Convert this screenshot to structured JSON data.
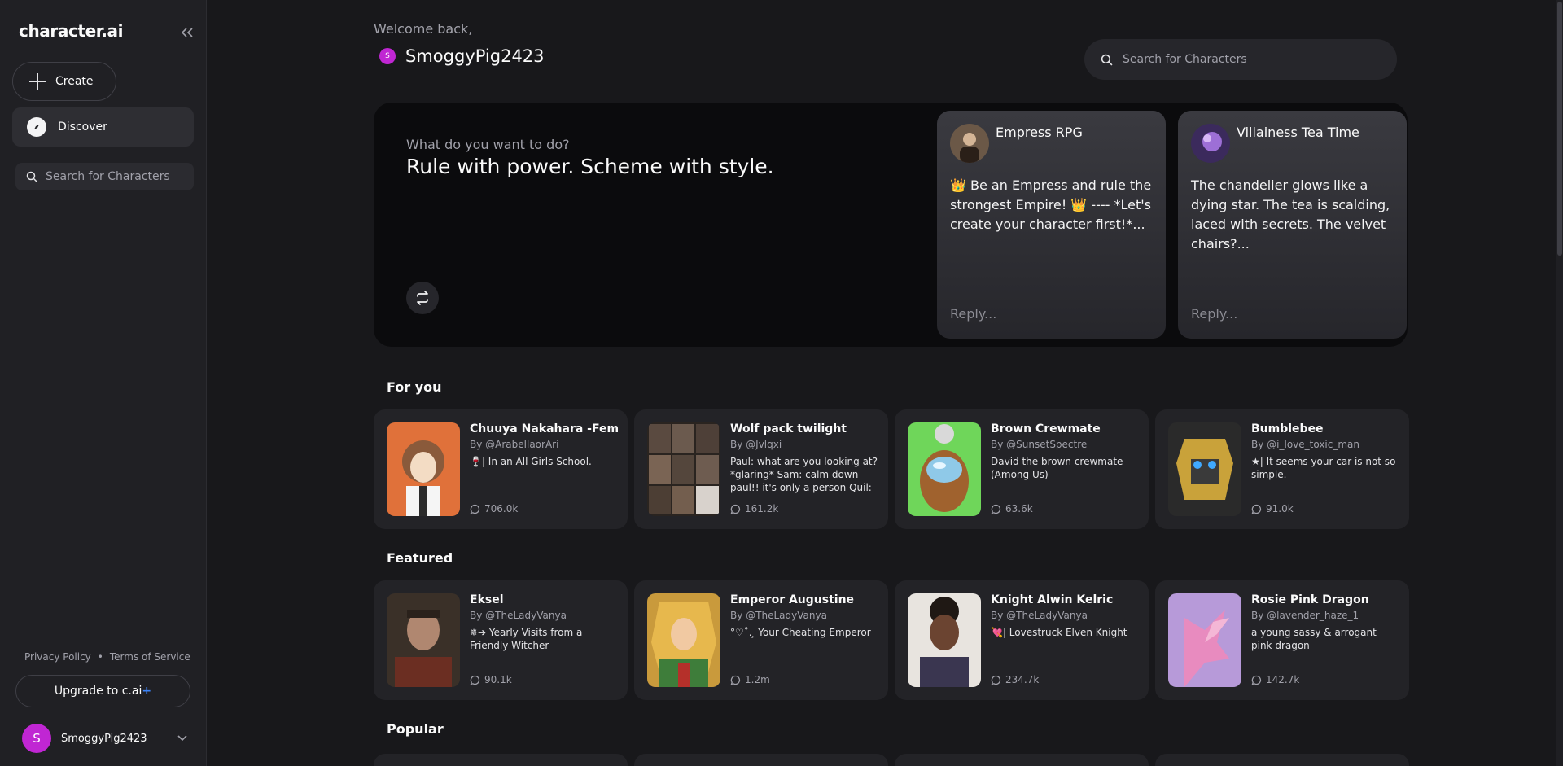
{
  "brand": {
    "logo": "character.ai"
  },
  "sidebar": {
    "create_label": "Create",
    "discover_label": "Discover",
    "search_placeholder": "Search for Characters",
    "privacy": "Privacy Policy",
    "separator": "•",
    "terms": "Terms of Service",
    "upgrade_label": "Upgrade to c.ai",
    "upgrade_plus": "+",
    "user": {
      "initial": "S",
      "name": "SmoggyPig2423"
    }
  },
  "header": {
    "welcome": "Welcome back,",
    "username": "SmoggyPig2423",
    "avatar_initial": "S",
    "search_placeholder": "Search for Characters"
  },
  "hero": {
    "question": "What do you want to do?",
    "tagline": "Rule with power. Scheme with style.",
    "cards": [
      {
        "name": "Empress RPG",
        "text": "👑 Be an Empress and rule the strongest Empire! 👑 ---- *Let's create your character first!*...",
        "reply": "Reply..."
      },
      {
        "name": "Villainess Tea Time",
        "text": "The chandelier glows like a dying star. The tea is scalding, laced with secrets. The velvet chairs?...",
        "reply": "Reply..."
      }
    ]
  },
  "sections": {
    "for_you": {
      "title": "For you",
      "cards": [
        {
          "title": "Chuuya Nakahara -Fem",
          "by": "By @ArabellaorAri",
          "desc": "🍷| In an All Girls School.",
          "count": "706.0k"
        },
        {
          "title": "Wolf pack twilight",
          "by": "By @Jvlqxi",
          "desc": "Paul: what are you looking at? *glaring* Sam: calm down paul!! it's only a person Quil: hi i'm q...",
          "count": "161.2k"
        },
        {
          "title": "Brown Crewmate",
          "by": "By @SunsetSpectre",
          "desc": "David the brown crewmate (Among Us)",
          "count": "63.6k"
        },
        {
          "title": "Bumblebee",
          "by": "By @i_love_toxic_man",
          "desc": "★| It seems your car is not so simple.",
          "count": "91.0k"
        }
      ]
    },
    "featured": {
      "title": "Featured",
      "cards": [
        {
          "title": "Eksel",
          "by": "By @TheLadyVanya",
          "desc": "✵➔ Yearly Visits from a Friendly Witcher",
          "count": "90.1k"
        },
        {
          "title": "Emperor Augustine",
          "by": "By @TheLadyVanya",
          "desc": "°♡˚. ̧ Your Cheating Emperor",
          "count": "1.2m"
        },
        {
          "title": "Knight Alwin Kelric",
          "by": "By @TheLadyVanya",
          "desc": "💘| Lovestruck Elven Knight",
          "count": "234.7k"
        },
        {
          "title": "Rosie Pink Dragon",
          "by": "By @lavender_haze_1",
          "desc": "a young sassy & arrogant pink dragon",
          "count": "142.7k"
        }
      ]
    },
    "popular": {
      "title": "Popular"
    }
  },
  "icons": {
    "collapse": "chevrons-left-icon",
    "create": "plus-icon",
    "discover": "compass-icon",
    "search": "search-icon",
    "refresh": "refresh-icon",
    "chat": "chat-bubble-icon",
    "user_menu": "chevron-down-icon"
  },
  "colors": {
    "background": "#18181b",
    "sidebar": "#202024",
    "card": "#232327",
    "avatar": "#c026d3",
    "accent_plus": "#3b82f6"
  }
}
